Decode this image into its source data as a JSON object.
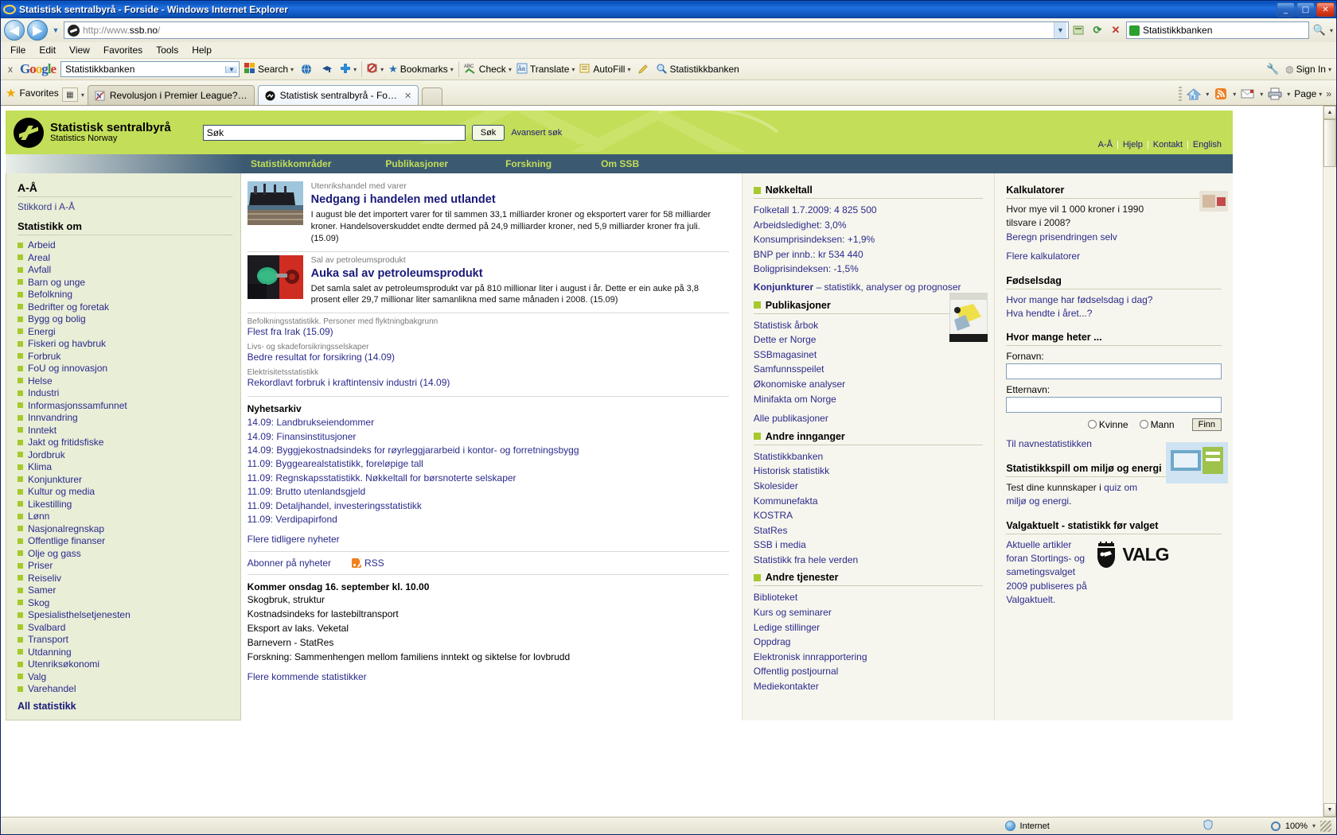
{
  "window": {
    "title": "Statistisk sentralbyrå - Forside - Windows Internet Explorer",
    "minimize": "_",
    "maximize": "□",
    "close": "✕"
  },
  "browser": {
    "back_icon": "◀",
    "forward_icon": "▶",
    "history_dropdown": "▼",
    "url": "http://www.ssb.no/",
    "url_host": "ssb.no",
    "addr_dropdown": "▼",
    "refresh_icon": "⟳",
    "stop_icon": "✕",
    "compat_icon": "▤",
    "search_provider": "Statistikkbanken",
    "search_go_icon": "🔍",
    "search_drop": "▾",
    "menu": [
      "File",
      "Edit",
      "View",
      "Favorites",
      "Tools",
      "Help"
    ]
  },
  "gtoolbar": {
    "close_label": "x",
    "logo": "Google",
    "query": "Statistikkbanken",
    "dropdown": "▼",
    "items": [
      {
        "label": "Search",
        "arrow": "▾",
        "icon": "google-search-icon"
      },
      {
        "label": "",
        "arrow": "",
        "icon": "translate-globe-icon"
      },
      {
        "label": "",
        "arrow": "",
        "icon": "scholar-cap-icon"
      },
      {
        "label": "",
        "arrow": "▾",
        "icon": "plus-icon"
      },
      {
        "label": "",
        "arrow": "▾",
        "icon": "popup-blocker-icon"
      },
      {
        "label": "Bookmarks",
        "arrow": "▾",
        "icon": "star-icon"
      },
      {
        "label": "Check",
        "arrow": "▾",
        "icon": "spellcheck-icon"
      },
      {
        "label": "Translate",
        "arrow": "▾",
        "icon": "translate-icon"
      },
      {
        "label": "AutoFill",
        "arrow": "▾",
        "icon": "autofill-icon"
      },
      {
        "label": "",
        "arrow": "",
        "icon": "highlighter-icon"
      },
      {
        "label": "Statistikkbanken",
        "arrow": "",
        "icon": "find-icon"
      }
    ],
    "signin": "Sign In",
    "settings_icon": "🔧",
    "signin_arrow": "▾"
  },
  "tabs": {
    "favorites_label": "Favorites",
    "favorites_star": "★",
    "grid_icon": "▦",
    "grid_arrow": "▾",
    "items": [
      {
        "label": "Revolusjon i Premier League?…",
        "active": false,
        "favicon": "N"
      },
      {
        "label": "Statistisk sentralbyrå - Fo…",
        "active": true,
        "favicon": "ssb"
      }
    ],
    "close_icon": "✕",
    "commands": [
      {
        "name": "home-icon",
        "arrow": "▾"
      },
      {
        "name": "feeds-icon",
        "arrow": "▾"
      },
      {
        "name": "mail-icon",
        "arrow": "▾"
      },
      {
        "name": "print-icon",
        "arrow": "▾"
      },
      {
        "name": "page-menu",
        "label": "Page",
        "arrow": "▾"
      }
    ],
    "overflow": "»"
  },
  "site": {
    "logo_line1": "Statistisk sentralbyrå",
    "logo_line2": "Statistics Norway",
    "search_value": "Søk",
    "search_button": "Søk",
    "advanced_search": "Avansert søk",
    "toplinks": [
      "A-Å",
      "Hjelp",
      "Kontakt",
      "English"
    ],
    "nav": [
      "Statistikkområder",
      "Publikasjoner",
      "Forskning",
      "Om SSB"
    ]
  },
  "left": {
    "heading_az": "A-Å",
    "link_stikkord": "Stikkord i A-Å",
    "heading_stat": "Statistikk om",
    "items": [
      "Arbeid",
      "Areal",
      "Avfall",
      "Barn og unge",
      "Befolkning",
      "Bedrifter og foretak",
      "Bygg og bolig",
      "Energi",
      "Fiskeri og havbruk",
      "Forbruk",
      "FoU og innovasjon",
      "Helse",
      "Industri",
      "Informasjonssamfunnet",
      "Innvandring",
      "Inntekt",
      "Jakt og fritidsfiske",
      "Jordbruk",
      "Klima",
      "Konjunkturer",
      "Kultur og media",
      "Likestilling",
      "Lønn",
      "Nasjonalregnskap",
      "Offentlige finanser",
      "Olje og gass",
      "Priser",
      "Reiseliv",
      "Samer",
      "Skog",
      "Spesialisthelsetjenesten",
      "Svalbard",
      "Transport",
      "Utdanning",
      "Utenriksøkonomi",
      "Valg",
      "Varehandel"
    ],
    "all_stat": "All statistikk"
  },
  "main": {
    "features": [
      {
        "kicker": "Utenrikshandel med varer",
        "title": "Nedgang i handelen med utlandet",
        "body": "I august ble det importert varer for til sammen 33,1 milliarder kroner og eksportert varer for 58 milliarder kroner. Handelsoverskuddet endte dermed på 24,9 milliarder kroner, ned 5,9 milliarder kroner fra juli. (15.09)",
        "image": "cargo-ship-photo"
      },
      {
        "kicker": "Sal av petroleumsprodukt",
        "title": "Auka sal av petroleumsprodukt",
        "body": "Det samla salet av petroleumsprodukt var på 810 millionar liter i august i år. Dette er ein auke på 3,8 prosent eller 29,7 millionar liter samanlikna med same månaden i 2008. (15.09)",
        "image": "fuel-pump-photo"
      }
    ],
    "briefs": [
      {
        "kicker": "Befolkningsstatistikk. Personer med flyktningbakgrunn",
        "link": "Flest fra Irak (15.09)"
      },
      {
        "kicker": "Livs- og skadeforsikringsselskaper",
        "link": "Bedre resultat for forsikring (14.09)"
      },
      {
        "kicker": "Elektrisitetsstatistikk",
        "link": "Rekordlavt forbruk i kraftintensiv industri (14.09)"
      }
    ],
    "archive_heading": "Nyhetsarkiv",
    "archive": [
      "14.09: Landbrukseiendommer",
      "14.09: Finansinstitusjoner",
      "14.09: Byggjekostnadsindeks for røyrleggjararbeid i kontor- og forretningsbygg",
      "11.09: Byggearealstatistikk, foreløpige tall",
      "11.09: Regnskapsstatistikk. Nøkkeltall for børsnoterte selskaper",
      "11.09: Brutto utenlandsgjeld",
      "11.09: Detaljhandel, investeringsstatistikk",
      "11.09: Verdipapirfond"
    ],
    "more_news": "Flere tidligere nyheter",
    "subscribe": "Abonner på nyheter",
    "rss": "RSS",
    "coming_heading": "Kommer onsdag 16. september kl. 10.00",
    "coming": [
      "Skogbruk, struktur",
      "Kostnadsindeks for lastebiltransport",
      "Eksport av laks. Veketal",
      "Barnevern - StatRes",
      "Forskning: Sammenhengen mellom familiens inntekt og siktelse for lovbrudd"
    ],
    "more_coming": "Flere kommende statistikker"
  },
  "mid": {
    "key_figures_heading": "Nøkkeltall",
    "key_figures": [
      "Folketall 1.7.2009: 4 825 500",
      "Arbeidsledighet: 3,0%",
      "Konsumprisindeksen: +1,9%",
      "BNP per innb.: kr 534 440",
      "Boligprisindeksen: -1,5%"
    ],
    "konjunkturer_bold": "Konjunkturer",
    "konjunkturer_rest": " – statistikk, analyser og prognoser",
    "publications_heading": "Publikasjoner",
    "publications": [
      "Statistisk årbok",
      "Dette er Norge",
      "SSBmagasinet",
      "Samfunnsspeilet",
      "Økonomiske analyser",
      "Minifakta om Norge"
    ],
    "all_publications": "Alle publikasjoner",
    "other_entries_heading": "Andre innganger",
    "other_entries": [
      "Statistikkbanken",
      "Historisk statistikk",
      "Skolesider",
      "Kommunefakta",
      "KOSTRA",
      "StatRes",
      "SSB i media",
      "Statistikk fra hele verden"
    ],
    "other_services_heading": "Andre tjenester",
    "other_services": [
      "Biblioteket",
      "Kurs og seminarer",
      "Ledige stillinger",
      "Oppdrag",
      "Elektronisk innrapportering",
      "Offentlig postjournal",
      "Mediekontakter"
    ]
  },
  "right": {
    "calc_heading": "Kalkulatorer",
    "calc_question": "Hvor mye vil 1 000 kroner i 1990 tilsvare i 2008?",
    "calc_link": "Beregn prisendringen selv",
    "calc_more": "Flere kalkulatorer",
    "birthday_heading": "Fødselsdag",
    "birthday_links": [
      "Hvor mange har fødselsdag i dag?",
      "Hva hendte i året...?"
    ],
    "names_heading": "Hvor mange heter ...",
    "first_name_label": "Fornavn:",
    "first_name_value": "",
    "last_name_label": "Etternavn:",
    "last_name_value": "",
    "radio_female": "Kvinne",
    "radio_male": "Mann",
    "find_button": "Finn",
    "names_link": "Til navnestatistikken",
    "quiz_heading": "Statistikkspill om miljø og energi",
    "quiz_text_pre": "Test dine kunnskaper i ",
    "quiz_text_link": "quiz om miljø og energi",
    "quiz_text_post": ".",
    "election_heading": "Valgaktuelt - statistikk før valget",
    "election_text": "Aktuelle artikler foran Stortings- og sametingsvalget 2009 publiseres på Valgaktuelt.",
    "valg_logo": "VALG"
  },
  "status": {
    "zone": "Internet",
    "zone_icon": "globe-icon",
    "protected_icon": "shield-icon",
    "zoom": "100%",
    "zoom_arrow": "▾"
  },
  "colors": {
    "ssb_green": "#c3de58",
    "ssb_navy": "#3b5a72",
    "link_blue": "#2a2a8c",
    "bullet_green": "#a6c92e",
    "sidebar_bg": "#e9eed7"
  }
}
